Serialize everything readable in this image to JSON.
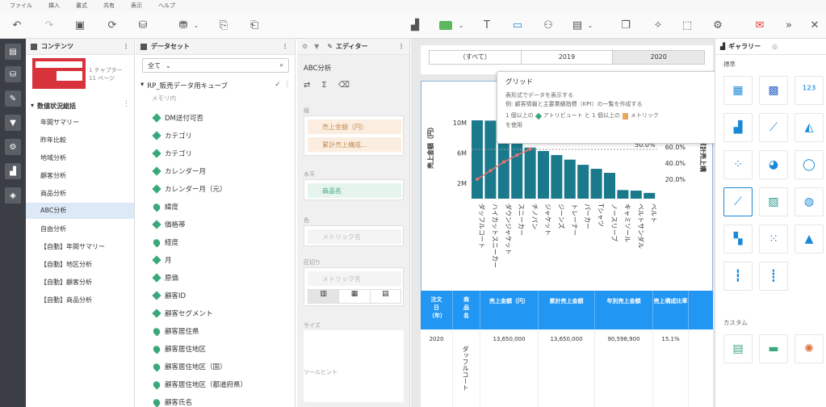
{
  "menu": [
    "ファイル",
    "挿入",
    "書式",
    "共有",
    "表示",
    "ヘルプ"
  ],
  "contents": {
    "title": "コンテンツ",
    "thumb_line1": "1 チャプター",
    "thumb_line2": "11 ページ",
    "chapter": "数値状況総括",
    "pages": [
      "年間サマリー",
      "昨年比較",
      "地域分析",
      "顧客分析",
      "商品分析",
      "ABC分析",
      "自由分析",
      "【自動】年間サマリー",
      "【自動】地区分析",
      "【自動】顧客分析",
      "【自動】商品分析"
    ],
    "selected_index": 5
  },
  "dataset": {
    "title": "データセット",
    "filter": "全て",
    "cube": "RP_販売データ用キューブ",
    "sub": "メモリ内",
    "fields": [
      {
        "label": "DM送付可否",
        "icon": "diamond"
      },
      {
        "label": "カテゴリ",
        "icon": "diamond"
      },
      {
        "label": "カテゴリ",
        "icon": "diamond"
      },
      {
        "label": "カレンダー月",
        "icon": "diamond"
      },
      {
        "label": "カレンダー月（元）",
        "icon": "diamond"
      },
      {
        "label": "緯度",
        "icon": "pin"
      },
      {
        "label": "価格帯",
        "icon": "diamond"
      },
      {
        "label": "経度",
        "icon": "pin"
      },
      {
        "label": "月",
        "icon": "diamond"
      },
      {
        "label": "原価",
        "icon": "diamond"
      },
      {
        "label": "顧客ID",
        "icon": "diamond"
      },
      {
        "label": "顧客セグメント",
        "icon": "diamond"
      },
      {
        "label": "顧客居住県",
        "icon": "pin"
      },
      {
        "label": "顧客居住地区",
        "icon": "pin"
      },
      {
        "label": "顧客居住地区（国）",
        "icon": "pin"
      },
      {
        "label": "顧客居住地区（都道府県）",
        "icon": "pin"
      },
      {
        "label": "顧客氏名",
        "icon": "pin"
      }
    ]
  },
  "editor": {
    "tab": "エディター",
    "viz_name": "ABC分析",
    "vertical_label": "縦",
    "vertical_items": [
      "売上金額（円）",
      "累計売上構成..."
    ],
    "horizontal_label": "水平",
    "horizontal_item": "商品名",
    "color_label": "色",
    "color_placeholder": "メトリック名",
    "slice_label": "区切り",
    "slice_placeholder": "メトリック名",
    "size_label": "サイズ",
    "tooltip_label": "ツールヒント"
  },
  "canvas": {
    "years": [
      "（すべて）",
      "2019",
      "2020"
    ],
    "selected_year": 2,
    "chart_data": {
      "type": "bar",
      "categories": [
        "ダッフルコート",
        "ハイカットスニーカー",
        "ダウンジャケット",
        "スニーカー",
        "チノパン",
        "ジャケット",
        "ジーンズ",
        "トレーナー",
        "パーカー",
        "Tシャツ",
        "ノースリーブ",
        "キャミソール",
        "ベルトサンダル",
        "ベルト"
      ],
      "values": [
        13.65,
        13.6,
        12.5,
        10.5,
        8.9,
        8.3,
        7.6,
        6.8,
        5.9,
        5.2,
        4.5,
        1.5,
        1.4,
        1.0
      ],
      "ylabel": "売上金額（円）",
      "yticks": [
        "10M",
        "6M",
        "2M"
      ],
      "y2label": "累計売上構",
      "y2ticks": [
        "60.0%",
        "40.0%",
        "20.0%"
      ],
      "ref_label": "50.0%",
      "line": [
        0.15,
        0.25,
        0.35,
        0.43,
        0.5
      ]
    },
    "tooltip": {
      "title": "グリッド",
      "line1": "表形式でデータを表示する",
      "line2": "例: 顧客情報と主要業績指標（KPI）の一覧を作成する",
      "line3a": "1 個以上の",
      "line3b": "アトリビュート と 1 個以上の",
      "line3c": "メトリック",
      "line4": "を使用"
    },
    "table": {
      "headers": [
        "注文日（年）",
        "商品名",
        "売上金額（円）",
        "累計売上金額",
        "年別売上金額",
        "売上構成比率"
      ],
      "row": [
        "2020",
        "ダッフルコート",
        "13,650,000",
        "13,650,000",
        "90,598,900",
        "15.1%"
      ]
    }
  },
  "gallery": {
    "tab": "ギャラリー",
    "section1": "標準",
    "section2": "カスタム"
  },
  "colors": {
    "bar": "#1a7a8c",
    "header": "#2196f3",
    "line": "#f07070"
  }
}
